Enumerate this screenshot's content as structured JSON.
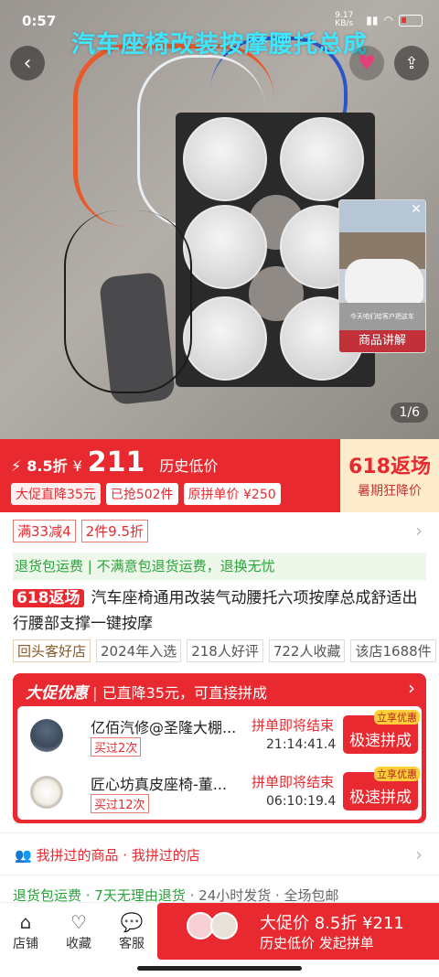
{
  "status_bar": {
    "time": "0:57",
    "net_speed": "9.17 KB/s",
    "battery": "11"
  },
  "hero": {
    "overlay_title": "汽车座椅改装按摩腰托总成",
    "mini_video": {
      "caption": "今天咱们给客户把这车",
      "label": "商品讲解"
    },
    "pager": "1/6"
  },
  "price_banner": {
    "discount": "8.5折",
    "currency": "¥",
    "price": "211",
    "history_label": "历史低价",
    "chips": [
      "大促直降35元",
      "已抢502件",
      "原拼单价 ¥250"
    ],
    "promo_big": "618返场",
    "promo_small": "暑期狂降价"
  },
  "coupons": [
    "满33减4",
    "2件9.5折"
  ],
  "return_banner": "退货包运费 | 不满意包退货运费，退换无忧",
  "product": {
    "tag": "618返场",
    "title": "汽车座椅通用改装气动腰托六项按摩总成舒适出行腰部支撑一键按摩"
  },
  "tags": [
    "回头客好店",
    "2024年入选",
    "218人好评",
    "722人收藏",
    "该店1688件"
  ],
  "group_buy": {
    "header_brand": "大促优惠",
    "header_text": "已直降35元，可直接拼成",
    "rows": [
      {
        "name": "亿佰汽修@圣隆大棚...",
        "bought": "买过2次",
        "status": "拼单即将结束",
        "time": "21:14:41.4",
        "badge": "立享优惠",
        "button": "极速拼成"
      },
      {
        "name": "匠心坊真皮座椅-董...",
        "bought": "买过12次",
        "status": "拼单即将结束",
        "time": "06:10:19.4",
        "badge": "立享优惠",
        "button": "极速拼成"
      }
    ]
  },
  "my_groups": "我拼过的商品 · 我拼过的店",
  "services": {
    "green": "退货包运费 · 7天无理由退货",
    "gray": " · 24小时发货 · 全场包邮"
  },
  "bottom_bar": {
    "store": "店铺",
    "favorite": "收藏",
    "service": "客服",
    "buy_line1": "大促价 8.5折 ¥211",
    "buy_line2": "历史低价 发起拼单"
  },
  "colors": {
    "brand_red": "#e8292f",
    "promo_beige": "#fdeccc",
    "green": "#2aa33b"
  },
  "icons": [
    "back-icon",
    "share-icon",
    "store-icon",
    "heart-icon",
    "chat-icon",
    "group-icon",
    "chevron-right-icon"
  ]
}
